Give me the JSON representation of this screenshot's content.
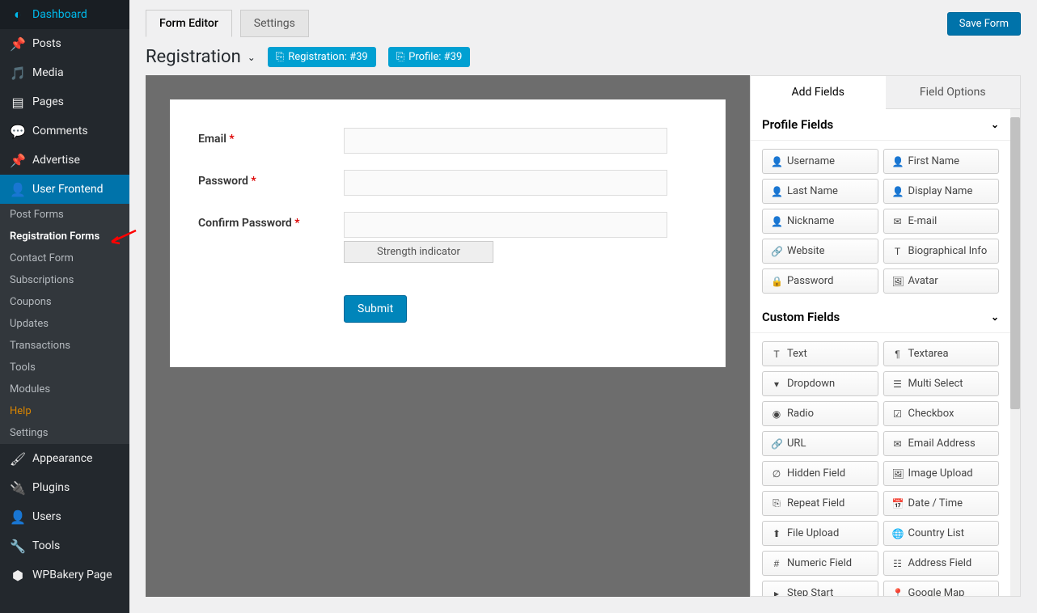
{
  "sidebar": {
    "items": [
      {
        "label": "Dashboard"
      },
      {
        "label": "Posts"
      },
      {
        "label": "Media"
      },
      {
        "label": "Pages"
      },
      {
        "label": "Comments"
      },
      {
        "label": "Advertise"
      },
      {
        "label": "User Frontend"
      },
      {
        "label": "Appearance"
      },
      {
        "label": "Plugins"
      },
      {
        "label": "Users"
      },
      {
        "label": "Tools"
      },
      {
        "label": "WPBakery Page"
      }
    ],
    "submenu": [
      {
        "label": "Post Forms"
      },
      {
        "label": "Registration Forms"
      },
      {
        "label": "Contact Form"
      },
      {
        "label": "Subscriptions"
      },
      {
        "label": "Coupons"
      },
      {
        "label": "Updates"
      },
      {
        "label": "Transactions"
      },
      {
        "label": "Tools"
      },
      {
        "label": "Modules"
      },
      {
        "label": "Help"
      },
      {
        "label": "Settings"
      }
    ]
  },
  "topbar": {
    "tab_editor": "Form Editor",
    "tab_settings": "Settings",
    "save": "Save Form"
  },
  "header": {
    "title": "Registration",
    "badge_reg": "Registration: #39",
    "badge_prof": "Profile: #39"
  },
  "form": {
    "email": "Email",
    "password": "Password",
    "confirm": "Confirm Password",
    "strength": "Strength indicator",
    "submit": "Submit"
  },
  "panel": {
    "tab_add": "Add Fields",
    "tab_options": "Field Options",
    "section_profile": "Profile Fields",
    "section_custom": "Custom Fields",
    "profile_fields": [
      "Username",
      "First Name",
      "Last Name",
      "Display Name",
      "Nickname",
      "E-mail",
      "Website",
      "Biographical Info",
      "Password",
      "Avatar"
    ],
    "custom_fields": [
      "Text",
      "Textarea",
      "Dropdown",
      "Multi Select",
      "Radio",
      "Checkbox",
      "URL",
      "Email Address",
      "Hidden Field",
      "Image Upload",
      "Repeat Field",
      "Date / Time",
      "File Upload",
      "Country List",
      "Numeric Field",
      "Address Field",
      "Step Start",
      "Google Map"
    ]
  }
}
